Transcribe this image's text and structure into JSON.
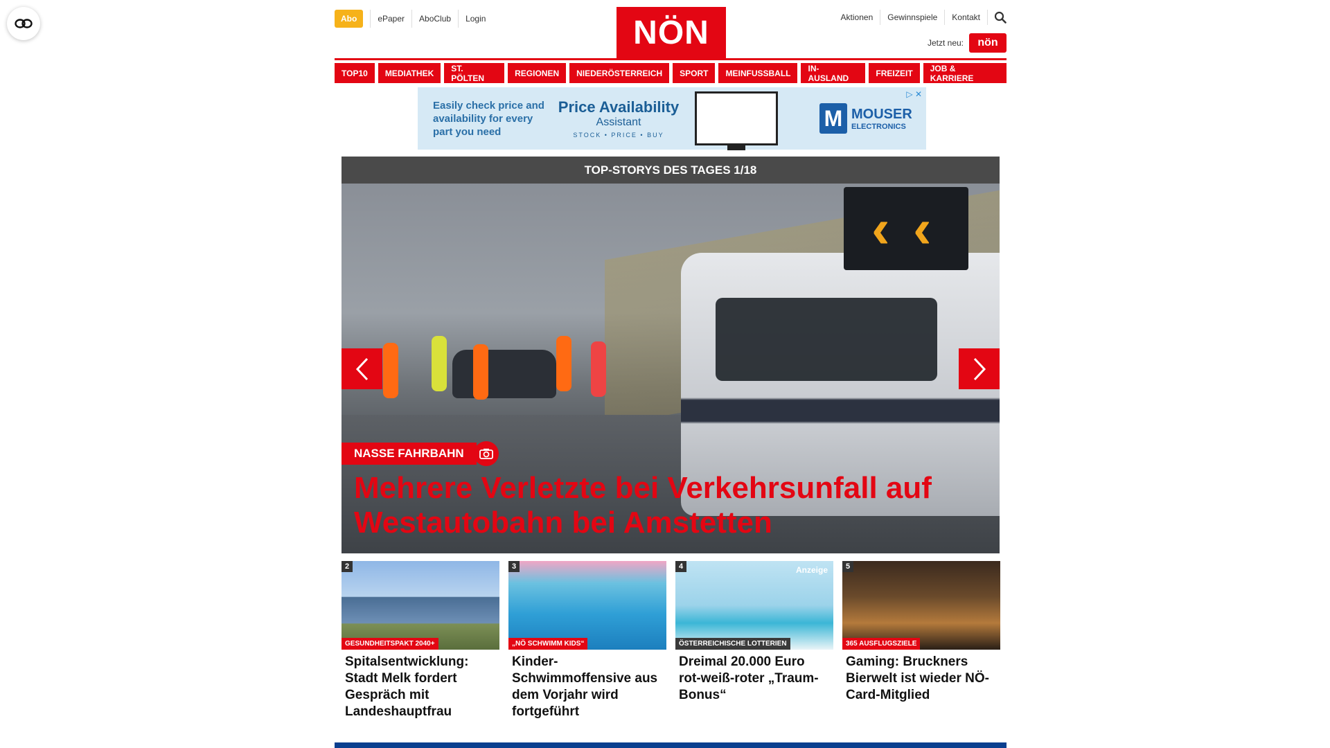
{
  "header": {
    "abo_label": "Abo",
    "top_links": [
      "ePaper",
      "AboClub",
      "Login"
    ],
    "logo_text": "NÖN",
    "right_links": [
      "Aktionen",
      "Gewinnspiele",
      "Kontakt"
    ],
    "jetzt_label": "Jetzt neu:",
    "mini_logo_text": "nön",
    "icons": {
      "search": "search-icon",
      "accessibility": "accessibility-icon"
    }
  },
  "nav": {
    "items": [
      "TOP10",
      "MEDIATHEK",
      "ST. PÖLTEN",
      "REGIONEN",
      "NIEDERÖSTERREICH",
      "SPORT",
      "MEINFUSSBALL",
      "IN-AUSLAND",
      "FREIZEIT",
      "JOB & KARRIERE"
    ]
  },
  "ad": {
    "text": "Easily check price and availability for every part you need",
    "brand_big": "Price Availability",
    "brand_sub": "Assistant",
    "brand_tags": "STOCK • PRICE • BUY",
    "mouser_letter": "M",
    "mouser_name": "MOUSER",
    "mouser_sub": "ELECTRONICS",
    "close_label": "▷ ✕"
  },
  "hero": {
    "header": "TOP-STORYS DES TAGES 1/18",
    "kicker": "NASSE FAHRBAHN",
    "title": "Mehrere Verletzte bei Verkehrsunfall auf Westautobahn bei Amstetten"
  },
  "cards": [
    {
      "num": "2",
      "tag": "GESUNDHEITSPAKT 2040+",
      "title": "Spitalsentwicklung: Stadt Melk fordert Gespräch mit Landeshauptfrau"
    },
    {
      "num": "3",
      "tag": "„NÖ SCHWIMM KIDS“",
      "title": "Kinder-Schwimmoffensive aus dem Vorjahr wird fortgeführt"
    },
    {
      "num": "4",
      "tag": "ÖSTERREICHISCHE LOTTERIEN",
      "ad_label": "Anzeige",
      "title": "Dreimal 20.000 Euro rot-weiß-roter „Traum-Bonus“"
    },
    {
      "num": "5",
      "tag": "365 AUSFLUGSZIELE",
      "title": "Gaming: Bruckners Bierwelt ist wieder NÖ-Card-Mitglied"
    }
  ],
  "colors": {
    "brand_red": "#e30613",
    "abo_yellow": "#f6b21a",
    "header_grey": "#4a4a4a",
    "footer_blue": "#0a3f8f"
  }
}
